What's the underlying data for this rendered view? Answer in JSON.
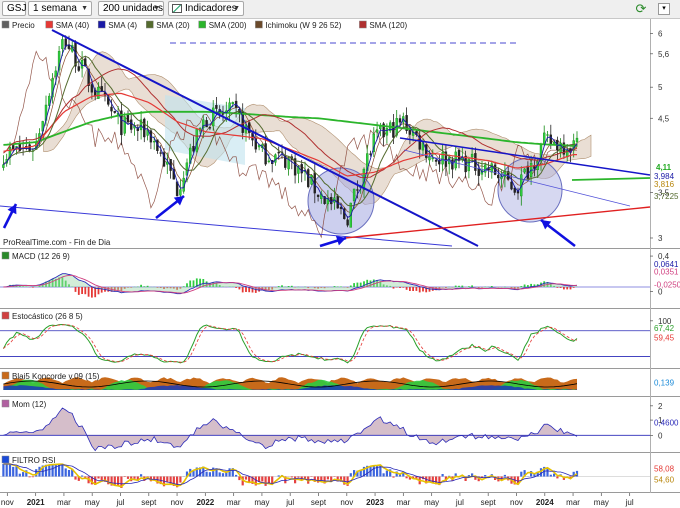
{
  "toolbar": {
    "symbol": "GSJ",
    "period": "1 semana",
    "units": "200 unidades",
    "indicators": "Indicadores"
  },
  "price_panel": {
    "legend": [
      {
        "name": "Precio",
        "color": "#606060"
      },
      {
        "name": "SMA (40)",
        "color": "#e53935"
      },
      {
        "name": "SMA (4)",
        "color": "#1a1aa6"
      },
      {
        "name": "SMA (20)",
        "color": "#556b2f"
      },
      {
        "name": "SMA (200)",
        "color": "#2bb52b"
      },
      {
        "name": "Ichimoku (W 9 26 52)",
        "color": "#6b4a2b"
      },
      {
        "name": "SMA (120)",
        "color": "#b03030"
      }
    ],
    "source_label": "ProRealTime.com - Fin de Dia",
    "axis_ticks": [
      "6",
      "5,6",
      "5",
      "4,5",
      "3,5",
      "3"
    ],
    "value_labels": [
      {
        "text": "4,11",
        "color": "#22aa22"
      },
      {
        "text": "3,984",
        "color": "#1a1aa6"
      },
      {
        "text": "3,7225",
        "color": "#556b2f"
      },
      {
        "text": "3,816",
        "color": "#b8860b"
      }
    ]
  },
  "panels": [
    {
      "name": "MACD (12 26 9)",
      "ticks": [
        "0,4",
        "0"
      ],
      "value_labels": [
        "0,0641",
        "0,0351",
        "-0,0250"
      ]
    },
    {
      "name": "Estocástico (26 8 5)",
      "ticks": [
        "100"
      ],
      "value_labels": [
        "67,42",
        "59,45"
      ]
    },
    {
      "name": "Blai5 Koncorde v.09 (15)",
      "ticks": [],
      "value_labels": [
        "0,139"
      ]
    },
    {
      "name": "Mom (12)",
      "ticks": [
        "2",
        "1",
        "0"
      ],
      "value_labels": [
        "0,4600"
      ]
    },
    {
      "name": "FILTRO RSI",
      "ticks": [],
      "value_labels": [
        "58,08",
        "54,60"
      ]
    }
  ],
  "x_axis": {
    "ticks": [
      "nov",
      "2021",
      "mar",
      "may",
      "jul",
      "sept",
      "nov",
      "2022",
      "mar",
      "may",
      "jul",
      "sept",
      "nov",
      "2023",
      "mar",
      "may",
      "jul",
      "sept",
      "nov",
      "2024",
      "mar",
      "may",
      "jul"
    ]
  },
  "chart_data": {
    "type": "line",
    "title": "GSJ",
    "period": "1 semana",
    "x_range": [
      "2020-10",
      "2024-08"
    ],
    "ylim": [
      2.9,
      6.3
    ],
    "y_scale": "log",
    "x": [
      "2020-10",
      "2021-01",
      "2021-03",
      "2021-05",
      "2021-07",
      "2021-09",
      "2021-11",
      "2022-01",
      "2022-03",
      "2022-05",
      "2022-07",
      "2022-09",
      "2022-11",
      "2023-01",
      "2023-03",
      "2023-05",
      "2023-07",
      "2023-09",
      "2023-11",
      "2024-01",
      "2024-03"
    ],
    "series": [
      {
        "name": "Precio",
        "values": [
          3.95,
          4.1,
          5.9,
          5.0,
          4.4,
          4.3,
          3.55,
          4.5,
          4.6,
          4.0,
          3.9,
          3.5,
          3.2,
          4.2,
          4.45,
          3.95,
          3.9,
          3.8,
          3.55,
          4.15,
          4.11
        ]
      },
      {
        "name": "SMA (200)",
        "values": [
          4.1,
          4.15,
          4.3,
          4.45,
          4.55,
          4.6,
          4.6,
          4.6,
          4.58,
          4.55,
          4.52,
          4.5,
          4.45,
          4.4,
          4.35,
          4.3,
          4.25,
          4.2,
          4.15,
          4.12,
          4.1
        ]
      },
      {
        "name": "SMA (40)",
        "values": [
          4.0,
          4.1,
          4.6,
          4.85,
          4.9,
          4.75,
          4.45,
          4.3,
          4.25,
          4.2,
          4.05,
          3.9,
          3.7,
          3.75,
          3.9,
          4.0,
          3.95,
          3.9,
          3.8,
          3.85,
          3.98
        ]
      }
    ]
  }
}
